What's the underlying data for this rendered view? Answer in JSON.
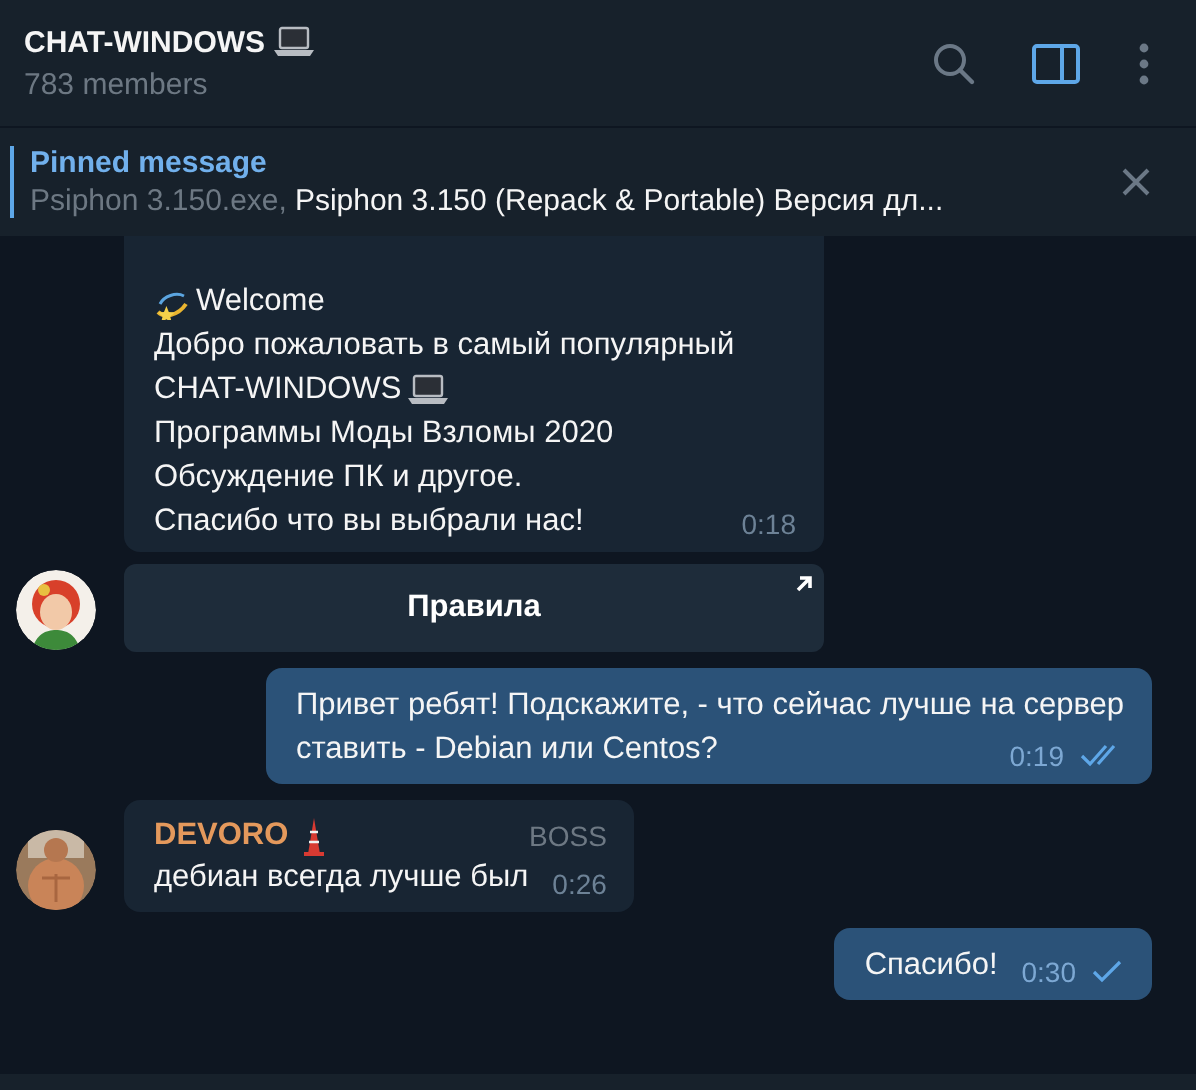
{
  "header": {
    "title": "CHAT-WINDOWS",
    "title_icon": true,
    "subtitle": "783 members"
  },
  "toolbar": [
    {
      "kind": "search",
      "active": false
    },
    {
      "kind": "sidebar",
      "active": true
    },
    {
      "kind": "more",
      "active": false
    }
  ],
  "pinned": {
    "label": "Pinned message",
    "file": "Psiphon 3.150.exe,",
    "text": "Psiphon 3.150 (Repack & Portable) Версия дл..."
  },
  "messages": [
    {
      "kind": "incoming",
      "avatar": false,
      "lines": [
        {
          "kind": "leading",
          "text": "Welcome"
        },
        {
          "kind": "plain",
          "text": "Добро пожаловать в самый популярный"
        },
        {
          "kind": "trailing",
          "text": "CHAT-WINDOWS"
        },
        {
          "kind": "plain",
          "text": "Программы Моды Взломы 2020"
        },
        {
          "kind": "plain",
          "text": "Обсуждение ПК и другое."
        },
        {
          "kind": "plain",
          "text": "Спасибо что вы выбрали нас!"
        }
      ],
      "time": "0:18"
    },
    {
      "kind": "button",
      "avatar": true,
      "label": "Правила"
    },
    {
      "kind": "outgoing",
      "lines": [
        {
          "kind": "plain",
          "text": "Привет ребят! Подскажите, - что сейчас лучше на сервер"
        },
        {
          "kind": "plain",
          "text": "ставить - Debian или Centos?"
        }
      ],
      "time": "0:19",
      "read": true
    },
    {
      "kind": "incoming",
      "avatar": true,
      "sender": "DEVORO",
      "sender_icon": true,
      "color": "#e4995c",
      "badge": "BOSS",
      "lines": [
        {
          "kind": "plain",
          "text": "дебиан всегда лучше был"
        }
      ],
      "time": "0:26"
    },
    {
      "kind": "outgoing",
      "lines": [
        {
          "kind": "plain",
          "text": "Спасибо!"
        }
      ],
      "time": "0:30",
      "read": false
    }
  ]
}
